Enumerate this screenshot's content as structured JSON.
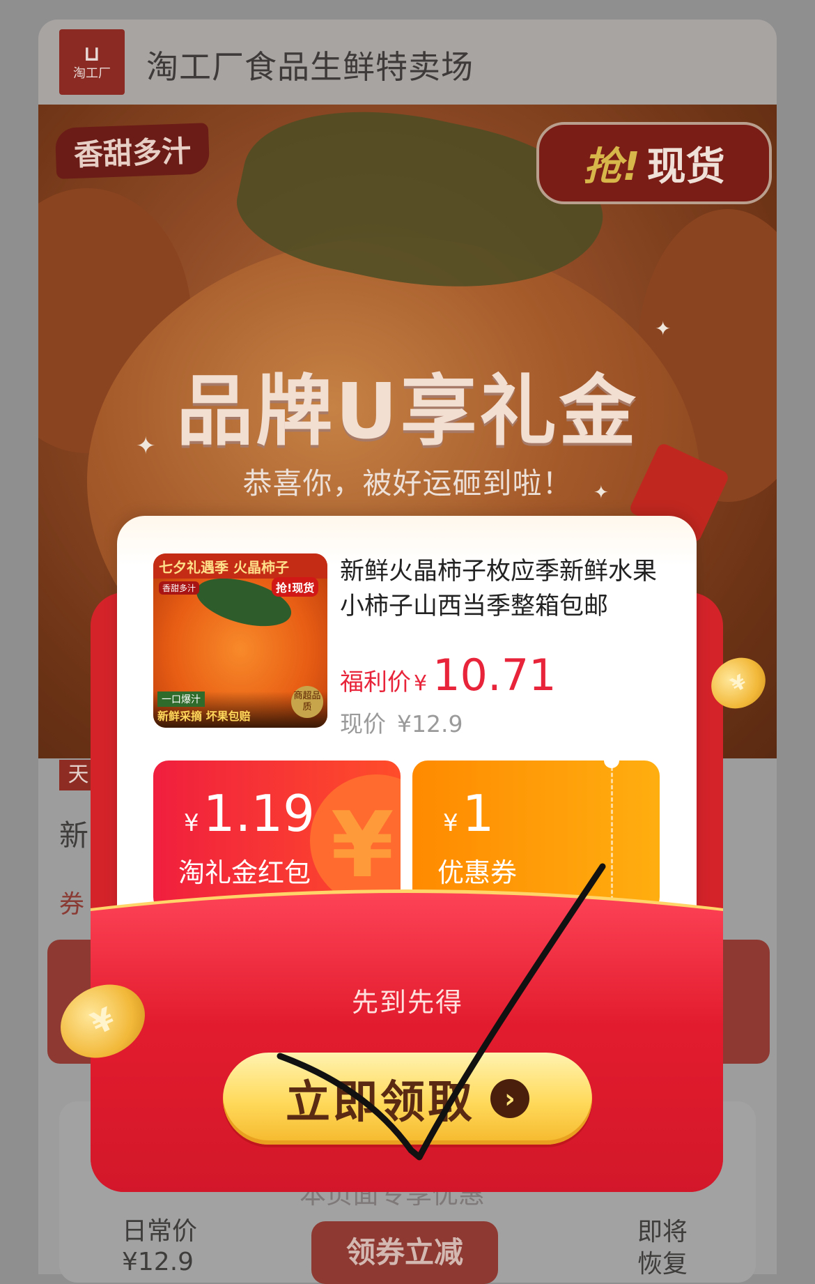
{
  "store": {
    "logo_text": "淘工厂",
    "title": "淘工厂食品生鲜特卖场"
  },
  "hero": {
    "tag_sweet": "香甜多汁",
    "tag_grab": "抢!",
    "tag_spot": "现货",
    "gift_title": "品牌U享礼金",
    "gift_subtitle": "恭喜你，被好运砸到啦！"
  },
  "product": {
    "name": "新鲜火晶柿子枚应季新鲜水果小柿子山西当季整箱包邮",
    "image": {
      "top_text": "七夕礼遇季 火晶柿子",
      "sweet_tag": "香甜多汁",
      "spot_tag": "抢!现货",
      "bottom_tag": "一口爆汁",
      "bottom_text": "新鲜采摘 坏果包赔",
      "badge": "商超品质"
    },
    "price_label": "福利价",
    "price_yen": "¥",
    "price_value": "10.71",
    "orig_label": "现价",
    "orig_value": "¥12.9"
  },
  "coupons": [
    {
      "yen": "¥",
      "amount": "1.19",
      "label": "淘礼金红包",
      "color": "#f01f3e"
    },
    {
      "yen": "¥",
      "amount": "1",
      "label": "优惠券",
      "color": "#ff8a00"
    }
  ],
  "popup": {
    "first_come": "先到先得",
    "claim_label": "立即领取",
    "claim_arrow": "›"
  },
  "background": {
    "tag_tian": "天",
    "text_xin": "新",
    "text_quan": "券",
    "under_text": "本页面专享优惠",
    "daily_price_label": "日常价",
    "daily_price_value": "¥12.9",
    "soon_label": "即将",
    "soon_label2": "恢复",
    "reduce_label": "领券立减"
  },
  "coin_symbol": "¥",
  "colors": {
    "accent_red": "#e8243a",
    "envelope_red": "#d5232a",
    "button_gold": "#ffd95a"
  }
}
